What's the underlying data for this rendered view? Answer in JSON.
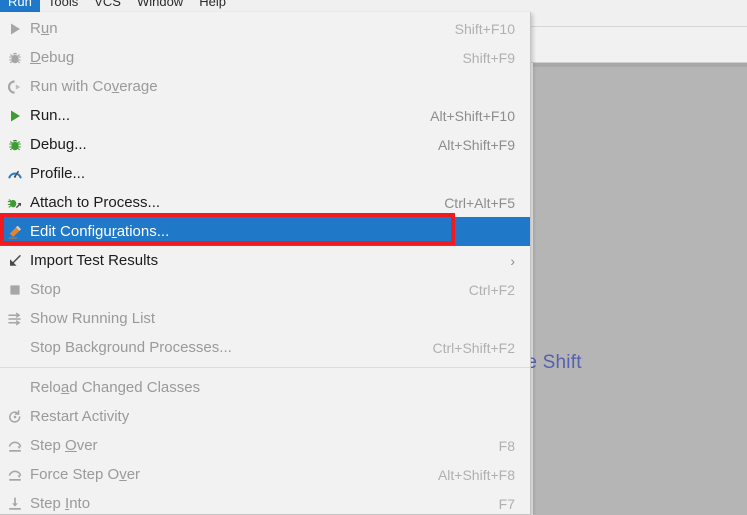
{
  "app": {
    "menubar_items": [
      "Tools",
      "VCS",
      "Window",
      "Help"
    ],
    "active_menu": "Run",
    "editor_hint": "le Shift"
  },
  "colors": {
    "selection_blue": "#1f78c8",
    "annotation_red": "#ee1c20",
    "menu_background": "#f2f2f2",
    "editor_gray": "#b5b5b5",
    "hint_blue": "#5560b0",
    "disabled_text": "#9a9a9a",
    "shortcut_text": "#8d8d8d"
  },
  "menu": {
    "name": "Run",
    "items": [
      {
        "id": "run",
        "label": "Run",
        "mnemonic": "u",
        "shortcut": "Shift+F10",
        "icon": "run-play-icon-disabled",
        "enabled": false,
        "selected": false,
        "submenu": false
      },
      {
        "id": "debug",
        "label": "Debug",
        "mnemonic": "D",
        "shortcut": "Shift+F9",
        "icon": "debug-bug-icon-disabled",
        "enabled": false,
        "selected": false,
        "submenu": false
      },
      {
        "id": "run-with-coverage",
        "label": "Run with Coverage",
        "mnemonic": "v",
        "shortcut": "",
        "icon": "coverage-icon-disabled",
        "enabled": false,
        "selected": false,
        "submenu": false
      },
      {
        "id": "run-dots",
        "label": "Run...",
        "mnemonic": "",
        "shortcut": "Alt+Shift+F10",
        "icon": "run-play-icon",
        "enabled": true,
        "selected": false,
        "submenu": false
      },
      {
        "id": "debug-dots",
        "label": "Debug...",
        "mnemonic": "",
        "shortcut": "Alt+Shift+F9",
        "icon": "debug-bug-icon",
        "enabled": true,
        "selected": false,
        "submenu": false
      },
      {
        "id": "profile-dots",
        "label": "Profile...",
        "mnemonic": "",
        "shortcut": "",
        "icon": "profile-gauge-icon",
        "enabled": true,
        "selected": false,
        "submenu": false
      },
      {
        "id": "attach-to-process",
        "label": "Attach to Process...",
        "mnemonic": "",
        "shortcut": "Ctrl+Alt+F5",
        "icon": "attach-process-icon",
        "enabled": true,
        "selected": false,
        "submenu": false
      },
      {
        "id": "edit-configurations",
        "label": "Edit Configurations...",
        "mnemonic": "r",
        "shortcut": "",
        "icon": "edit-pencil-icon",
        "enabled": true,
        "selected": true,
        "submenu": false
      },
      {
        "id": "import-test-results",
        "label": "Import Test Results",
        "mnemonic": "",
        "shortcut": "",
        "icon": "import-results-icon",
        "enabled": true,
        "selected": false,
        "submenu": true
      },
      {
        "id": "stop",
        "label": "Stop",
        "mnemonic": "",
        "shortcut": "Ctrl+F2",
        "icon": "stop-square-icon-disabled",
        "enabled": false,
        "selected": false,
        "submenu": false
      },
      {
        "id": "show-running-list",
        "label": "Show Running List",
        "mnemonic": "",
        "shortcut": "",
        "icon": "running-list-icon-disabled",
        "enabled": false,
        "selected": false,
        "submenu": false
      },
      {
        "id": "stop-background-processes",
        "label": "Stop Background Processes...",
        "mnemonic": "",
        "shortcut": "Ctrl+Shift+F2",
        "icon": "none",
        "enabled": false,
        "selected": false,
        "submenu": false
      },
      {
        "id": "reload-changed-classes",
        "label": "Reload Changed Classes",
        "mnemonic": "a",
        "shortcut": "",
        "icon": "none",
        "enabled": false,
        "selected": false,
        "submenu": false
      },
      {
        "id": "restart-activity",
        "label": "Restart Activity",
        "mnemonic": "",
        "shortcut": "",
        "icon": "restart-activity-icon",
        "enabled": false,
        "selected": false,
        "submenu": false
      },
      {
        "id": "step-over",
        "label": "Step Over",
        "mnemonic": "O",
        "shortcut": "F8",
        "icon": "step-over-icon",
        "enabled": false,
        "selected": false,
        "submenu": false
      },
      {
        "id": "force-step-over",
        "label": "Force Step Over",
        "mnemonic": "v",
        "shortcut": "Alt+Shift+F8",
        "icon": "step-over-icon",
        "enabled": false,
        "selected": false,
        "submenu": false
      },
      {
        "id": "step-into",
        "label": "Step Into",
        "mnemonic": "I",
        "shortcut": "F7",
        "icon": "step-into-icon",
        "enabled": false,
        "selected": false,
        "submenu": false
      }
    ],
    "separator_after": [
      "stop-background-processes"
    ],
    "submenu_arrow_glyph": "›"
  },
  "annotation": {
    "type": "rectangle-highlight",
    "target": "edit-configurations",
    "color": "#ee1c20"
  }
}
